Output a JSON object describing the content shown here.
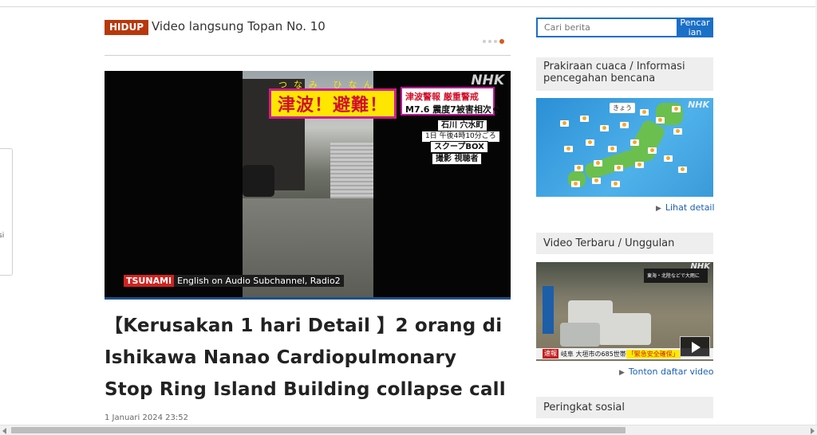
{
  "live": {
    "badge": "HIDUP",
    "title": "Video langsung Topan No. 10",
    "slides_total": 4,
    "slide_active": 4
  },
  "left_panel": {
    "frag1": "i",
    "frag2": "si"
  },
  "video": {
    "overlay_logo": "NHK",
    "ruby_top": "つなみ ひなん",
    "alert_main": "津波！避難！",
    "alert_line1": "津波警報 厳重警戒",
    "alert_line2": "M7.6 震度7被害相次ぐ",
    "place": "石川 穴水町",
    "time": "1日 午後4時10分ごろ",
    "box1": "スクープBOX",
    "box2": "撮影 視聴者",
    "caption_tag": "TSUNAMI",
    "caption_text": "English on Audio Subchannel, Radio2"
  },
  "article": {
    "headline": "【Kerusakan 1 hari Detail 】2 orang di Ishikawa Nanao Cardiopulmonary Stop Ring Island Building collapse call",
    "date": "1 Januari 2024 23:52"
  },
  "search": {
    "placeholder": "Cari berita",
    "button_line1": "Pencar",
    "button_line2": "ian"
  },
  "sidebar": {
    "weather_heading": "Prakiraan cuaca / Informasi pencegahan bencana",
    "weather_map_label": "きょう",
    "weather_map_logo": "NHK",
    "weather_link": "Lihat detail",
    "video_heading": "Video Terbaru / Unggulan",
    "video_logo": "NHK",
    "video_ticker_tag": "速報",
    "video_ticker_text": "岐阜 大垣市の685世帯",
    "video_ticker_alert": "「緊急安全確保」",
    "video_top_text": "東海・北陸などで大雨に",
    "video_link": "Tonton daftar video",
    "social_heading": "Peringkat sosial"
  },
  "colors": {
    "live_badge": "#b8380c",
    "accent_blue": "#1a6fc7",
    "link_blue": "#1a5fb4",
    "slide_dot_active": "#d85a1a"
  }
}
